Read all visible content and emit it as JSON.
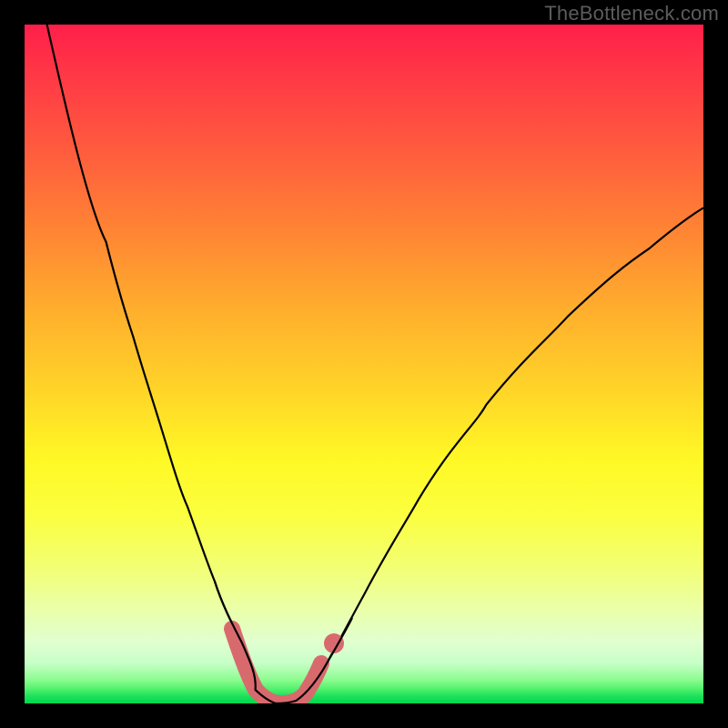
{
  "watermark": "TheBottleneck.com",
  "colors": {
    "curve": "#000000",
    "highlight": "#d86a6e",
    "gradient_top": "#ff1f4a",
    "gradient_bottom": "#00d84f"
  },
  "chart_data": {
    "type": "line",
    "title": "",
    "xlabel": "",
    "ylabel": "",
    "xlim": [
      0,
      100
    ],
    "ylim": [
      0,
      100
    ],
    "note": "Axes are unlabeled in the source; values estimated on a 0–100 scale from pixel positions. Curve starts at x≈3.3 at the top edge, dips to ~0 around x≈34–40, then rises to ~73 at x=100.",
    "series": [
      {
        "name": "bottleneck-curve",
        "x": [
          3.3,
          8,
          12,
          16,
          20,
          24,
          28,
          31,
          34,
          37,
          40,
          44,
          50,
          58,
          68,
          80,
          92,
          100
        ],
        "y": [
          100,
          83,
          68,
          54,
          41,
          29,
          18,
          9,
          2,
          0,
          0.4,
          5,
          16,
          30,
          44,
          57,
          67,
          73
        ]
      }
    ],
    "highlight_segments": [
      {
        "x_start": 30.5,
        "x_end": 42.0,
        "comment": "main U-shaped trough highlight"
      },
      {
        "x_start": 44.0,
        "x_end": 46.0,
        "comment": "small detached highlight just right of trough"
      }
    ]
  }
}
